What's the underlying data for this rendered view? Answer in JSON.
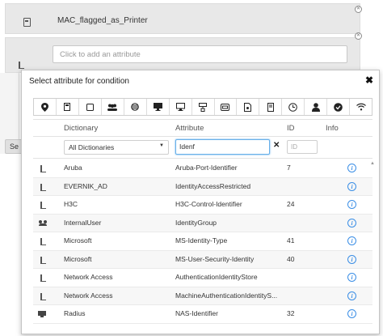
{
  "background": {
    "card1_title": "MAC_flagged_as_Printer",
    "add_attribute_placeholder": "Click to add an attribute",
    "side_button_label": "Se"
  },
  "dialog": {
    "title": "Select attribute for condition",
    "close_glyph": "✖"
  },
  "icon_bar": [
    "location-pin-icon",
    "square-icon",
    "square-outline-icon",
    "users-icon",
    "globe-icon",
    "monitor-icon",
    "display-icon",
    "network-icon",
    "card-icon",
    "document-icon",
    "server-icon",
    "clock-icon",
    "user-icon",
    "check-circle-icon",
    "wifi-icon"
  ],
  "table": {
    "headers": {
      "dictionary": "Dictionary",
      "attribute": "Attribute",
      "id": "ID",
      "info": "Info"
    },
    "filters": {
      "dictionary_value": "All Dictionaries",
      "attribute_value": "Idenf",
      "clear_glyph": "✕",
      "id_placeholder": "ID"
    },
    "rows": [
      {
        "icon": "tree-icon",
        "dictionary": "Aruba",
        "attribute": "Aruba-Port-Identifier",
        "id": "7"
      },
      {
        "icon": "tree-icon",
        "dictionary": "EVERNIK_AD",
        "attribute": "IdentityAccessRestricted",
        "id": ""
      },
      {
        "icon": "tree-icon",
        "dictionary": "H3C",
        "attribute": "H3C-Control-Identifier",
        "id": "24"
      },
      {
        "icon": "users-icon",
        "dictionary": "InternalUser",
        "attribute": "IdentityGroup",
        "id": ""
      },
      {
        "icon": "tree-icon",
        "dictionary": "Microsoft",
        "attribute": "MS-Identity-Type",
        "id": "41"
      },
      {
        "icon": "tree-icon",
        "dictionary": "Microsoft",
        "attribute": "MS-User-Security-Identity",
        "id": "40"
      },
      {
        "icon": "tree-icon",
        "dictionary": "Network Access",
        "attribute": "AuthenticationIdentityStore",
        "id": ""
      },
      {
        "icon": "tree-icon",
        "dictionary": "Network Access",
        "attribute": "MachineAuthenticationIdentityS...",
        "id": ""
      },
      {
        "icon": "monitor-icon",
        "dictionary": "Radius",
        "attribute": "NAS-Identifier",
        "id": "32"
      }
    ],
    "info_glyph": "i"
  },
  "colors": {
    "accent": "#3a8ee6",
    "focus_border": "#66afe9"
  }
}
